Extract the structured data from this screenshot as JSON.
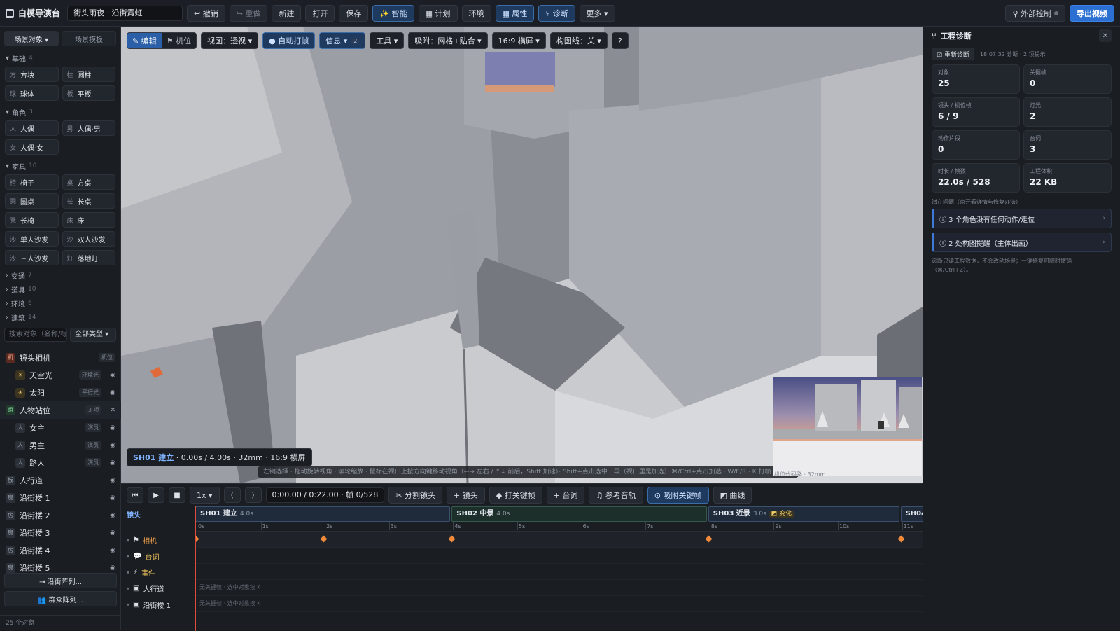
{
  "app": {
    "title": "白模导演台",
    "project": "街头雨夜 · 沿街霓虹"
  },
  "toolbar": {
    "undo": "↩ 撤销",
    "redo": "↪ 重做",
    "new": "新建",
    "open": "打开",
    "save": "保存",
    "ai": "✨ 智能",
    "plan": "▦ 计划",
    "env": "环境",
    "props": "▦ 属性",
    "diag": "⑂ 诊断",
    "more": "更多 ▾",
    "external": "⚲ 外部控制",
    "export": "导出视频"
  },
  "left": {
    "tabs": [
      "场景对象 ▾",
      "场景模板"
    ],
    "categories": [
      {
        "name": "基础",
        "count": "4",
        "items": [
          {
            "g": "方",
            "label": "方块"
          },
          {
            "g": "柱",
            "label": "圆柱"
          },
          {
            "g": "球",
            "label": "球体"
          },
          {
            "g": "板",
            "label": "平板"
          }
        ]
      },
      {
        "name": "角色",
        "count": "3",
        "items": [
          {
            "g": "人",
            "label": "人偶"
          },
          {
            "g": "男",
            "label": "人偶·男"
          },
          {
            "g": "女",
            "label": "人偶·女"
          }
        ]
      },
      {
        "name": "家具",
        "count": "10",
        "items": [
          {
            "g": "椅",
            "label": "椅子"
          },
          {
            "g": "桌",
            "label": "方桌"
          },
          {
            "g": "圆",
            "label": "圆桌"
          },
          {
            "g": "长",
            "label": "长桌"
          },
          {
            "g": "凳",
            "label": "长椅"
          },
          {
            "g": "床",
            "label": "床"
          },
          {
            "g": "沙",
            "label": "单人沙发"
          },
          {
            "g": "沙",
            "label": "双人沙发"
          },
          {
            "g": "沙",
            "label": "三人沙发"
          },
          {
            "g": "灯",
            "label": "落地灯"
          }
        ]
      }
    ],
    "collapsed": [
      {
        "name": "交通",
        "count": "7"
      },
      {
        "name": "道具",
        "count": "10"
      },
      {
        "name": "环境",
        "count": "6"
      },
      {
        "name": "建筑",
        "count": "14"
      }
    ],
    "search_placeholder": "搜索对象（名称/标",
    "type_filter": "全部类型 ▾",
    "tree": [
      {
        "g": "机",
        "label": "镜头相机",
        "tag": "机位",
        "kind": "cam"
      },
      {
        "g": "☀",
        "label": "天空光",
        "tag": "环境光",
        "kind": "light",
        "sub": true
      },
      {
        "g": "☀",
        "label": "太阳",
        "tag": "平行光",
        "kind": "light",
        "sub": true
      },
      {
        "g": "组",
        "label": "人物站位",
        "tag": "3 项",
        "kind": "grp"
      },
      {
        "g": "人",
        "label": "女主",
        "tag": "演员",
        "sub": true
      },
      {
        "g": "人",
        "label": "男主",
        "tag": "演员",
        "sub": true
      },
      {
        "g": "人",
        "label": "路人",
        "tag": "演员",
        "sub": true
      },
      {
        "g": "板",
        "label": "人行道",
        "tag": ""
      },
      {
        "g": "房",
        "label": "沿街楼 1",
        "tag": ""
      },
      {
        "g": "房",
        "label": "沿街楼 2",
        "tag": ""
      },
      {
        "g": "房",
        "label": "沿街楼 3",
        "tag": ""
      },
      {
        "g": "房",
        "label": "沿街楼 4",
        "tag": ""
      },
      {
        "g": "房",
        "label": "沿街楼 5",
        "tag": ""
      }
    ],
    "array_btn": "⇥ 沿街阵列...",
    "crowd_btn": "👥 群众阵列...",
    "count": "25 个对象"
  },
  "viewport": {
    "mode_edit": "✎ 编辑",
    "mode_cam": "⚑ 机位",
    "view": "视图：透视 ▾",
    "autokey": "● 自动打帧",
    "info": "信息 ▾",
    "info_count": "2",
    "tools": "工具 ▾",
    "snap": "吸附：网格+贴合 ▾",
    "aspect": "16:9 横屏 ▾",
    "compose": "构图线：关 ▾",
    "help": "?",
    "shot_code": "SH01 建立",
    "shot_info": " · 0.00s / 4.00s · 32mm · 16:9 横屏",
    "hint": "左键选择 · 拖动旋转视角 · 滚轮缩放 · 鼠标在视口上按方向键移动视角（←→ 左右 / ↑↓ 前后，Shift 加速）· Shift+点击选中一段（视口里是加选）· ⌘/Ctrl+点击加选 · W/E/R · K 打帧 · 空格播放",
    "mini_label": "机位代码路 · 32mm"
  },
  "timeline": {
    "speed": "1x ▾",
    "time": "0:00.00 / 0:22.00 · 帧 0/528",
    "split": "✂ 分割镜头",
    "add_shot": "+ 镜头",
    "keyframe": "◆ 打关键帧",
    "dialog": "+ 台词",
    "audio": "♫ 参考音轨",
    "snap_key": "⊙ 吸附关键帧",
    "curve": "◩ 曲线",
    "lanes_title": "镜头",
    "shots": [
      {
        "name": "SH01 建立",
        "dur": "4.0s"
      },
      {
        "name": "SH02 中景",
        "dur": "4.0s"
      },
      {
        "name": "SH03 近景",
        "dur": "3.0s",
        "badge": "◩ 变化"
      },
      {
        "name": "SH04",
        "dur": ""
      }
    ],
    "ticks": [
      "0s",
      "1s",
      "2s",
      "3s",
      "4s",
      "5s",
      "6s",
      "7s",
      "8s",
      "9s",
      "10s",
      "11s"
    ],
    "lanes": [
      {
        "label": "相机",
        "icon": "⚑"
      },
      {
        "label": "台词",
        "icon": "💬"
      },
      {
        "label": "事件",
        "icon": "⚡"
      },
      {
        "label": "人行道",
        "icon": "▣"
      },
      {
        "label": "沿街楼 1",
        "icon": "▣"
      }
    ],
    "keyframes_s": [
      0,
      2,
      4,
      8,
      11
    ],
    "no_key_text": "无关键帧 · 选中对象按 K"
  },
  "right": {
    "title": "工程诊断",
    "rerun": "☑ 重新诊断",
    "meta": "18:07:32 诊断 · 2 项提示",
    "stats": [
      {
        "k": "对象",
        "v": "25"
      },
      {
        "k": "关键帧",
        "v": "0"
      },
      {
        "k": "镜头 / 机位帧",
        "v": "6 / 9"
      },
      {
        "k": "灯光",
        "v": "2"
      },
      {
        "k": "动作片段",
        "v": "0"
      },
      {
        "k": "台词",
        "v": "3"
      },
      {
        "k": "时长 / 帧数",
        "v": "22.0s / 528"
      },
      {
        "k": "工程体积",
        "v": "22 KB"
      }
    ],
    "issues_title": "潜在问题（点开看详情与修复办法）",
    "issues": [
      "ⓘ 3 个角色没有任何动作/走位",
      "ⓘ 2 处构图提醒（主体出画）"
    ],
    "note": "诊断只读工程数据，不会改动场景；一键修复可随时撤销（⌘/Ctrl+Z）。"
  }
}
